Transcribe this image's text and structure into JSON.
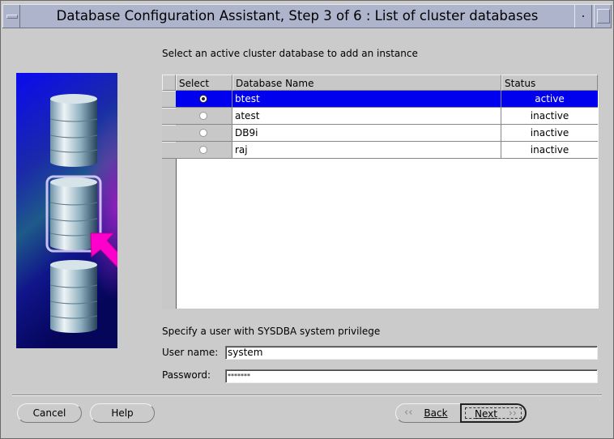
{
  "window": {
    "title": "Database Configuration Assistant, Step 3 of 6 : List of cluster databases"
  },
  "instruction": "Select an active cluster database to add an instance",
  "table": {
    "columns": [
      "Select",
      "Database Name",
      "Status"
    ],
    "rows": [
      {
        "name": "btest",
        "status": "active",
        "selected": true
      },
      {
        "name": "atest",
        "status": "inactive",
        "selected": false
      },
      {
        "name": "DB9i",
        "status": "inactive",
        "selected": false
      },
      {
        "name": "raj",
        "status": "inactive",
        "selected": false
      }
    ]
  },
  "credentials": {
    "heading": "Specify a user with SYSDBA system privilege",
    "username_label": "User name:",
    "username_value": "system",
    "password_label": "Password:",
    "password_value": "*******"
  },
  "buttons": {
    "cancel": "Cancel",
    "help": "Help",
    "back": "Back",
    "next": "Next"
  },
  "colors": {
    "selection": "#0000ee",
    "titlebar": "#aeb4cc",
    "arrow": "#ff00cc"
  }
}
